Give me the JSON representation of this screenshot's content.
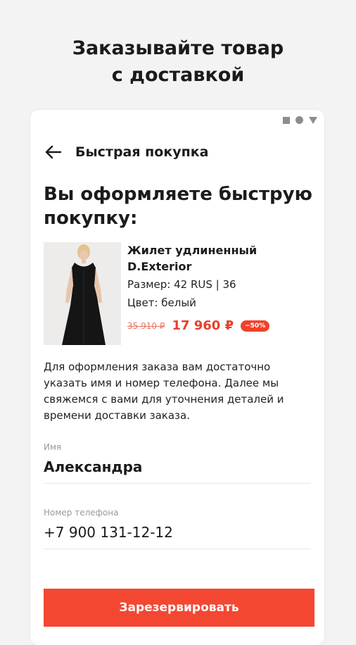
{
  "promo": {
    "line1": "Заказывайте товар",
    "line2": "с доставкой"
  },
  "appbar": {
    "title": "Быстрая покупка",
    "back_icon": "arrow-left-icon"
  },
  "statusbar": {
    "icons": [
      "square-icon",
      "circle-icon",
      "triangle-icon"
    ],
    "color": "#8d8d8d"
  },
  "heading": "Вы оформляете быструю покупку:",
  "product": {
    "name": "Жилет удлиненный D.Exterior",
    "size": "Размер: 42 RUS | 36",
    "color": "Цвет: белый",
    "old_price": "35 910 ₽",
    "new_price": "17 960 ₽",
    "discount": "−50%"
  },
  "description": "Для оформления заказа вам достаточно указать имя и номер телефона. Далее мы свяжемся с вами для уточнения деталей и времени доставки заказа.",
  "form": {
    "name_label": "Имя",
    "name_value": "Александра",
    "phone_label": "Номер телефона",
    "phone_value": "+7 900 131-12-12"
  },
  "cta": {
    "label": "Зарезервировать"
  },
  "colors": {
    "accent": "#f34732",
    "price": "#e8402b",
    "background": "#f3f3f4"
  }
}
